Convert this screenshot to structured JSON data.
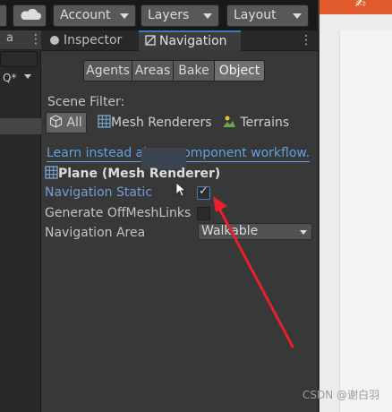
{
  "toolbar": {
    "account_label": "Account",
    "layers_label": "Layers",
    "layout_label": "Layout"
  },
  "left_panel": {
    "tab_label": "a",
    "search_fragment": "Q*"
  },
  "tabs": {
    "inspector": "Inspector",
    "navigation": "Navigation"
  },
  "modes": {
    "agents": "Agents",
    "areas": "Areas",
    "bake": "Bake",
    "object": "Object",
    "selected": "Object"
  },
  "scene_filter": {
    "label": "Scene Filter:",
    "all": "All",
    "mesh_renderers": "Mesh Renderers",
    "terrains": "Terrains"
  },
  "link_text": "Learn instead about component workflow.",
  "object": {
    "name": "Plane (Mesh Renderer)"
  },
  "fields": {
    "navigation_static_label": "Navigation Static",
    "navigation_static_checked": true,
    "offmesh_label": "Generate OffMeshLinks",
    "offmesh_checked": false,
    "area_label": "Navigation Area",
    "area_value": "Walkable"
  },
  "watermark": "CSDN @谢白羽",
  "colors": {
    "accent_blue": "#5fa2e3",
    "selected_tab_line": "#3a79bb",
    "annotation_arrow": "#e8202a"
  }
}
